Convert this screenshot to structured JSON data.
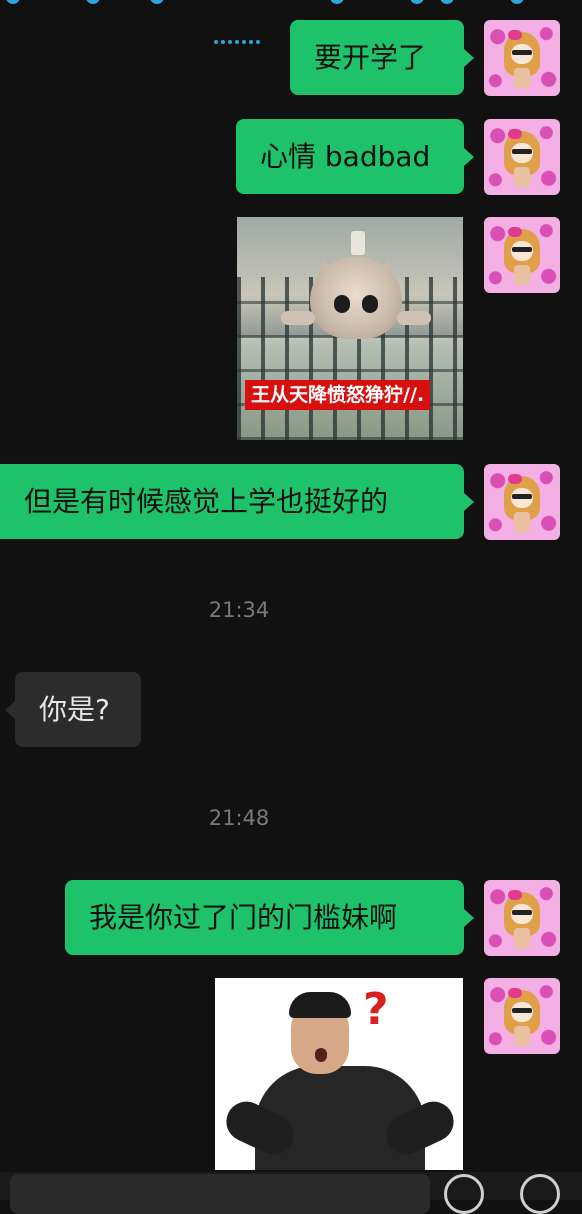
{
  "messages": [
    {
      "type": "text",
      "side": "mine",
      "text": "要开学了"
    },
    {
      "type": "text",
      "side": "mine",
      "text": "心情 badbad"
    },
    {
      "type": "sticker",
      "side": "mine",
      "caption": "王从天降愤怒狰狞//.",
      "icon": "cat-sticker"
    },
    {
      "type": "text",
      "side": "mine",
      "text": "但是有时候感觉上学也挺好的"
    },
    {
      "type": "time",
      "text": "21:34"
    },
    {
      "type": "text",
      "side": "theirs",
      "text": "你是?"
    },
    {
      "type": "time",
      "text": "21:48"
    },
    {
      "type": "text",
      "side": "mine",
      "text": "我是你过了门的门槛妹啊"
    },
    {
      "type": "sticker",
      "side": "mine",
      "icon": "surprised-man-sticker"
    }
  ],
  "colors": {
    "background": "#111111",
    "my_bubble": "#1ec26b",
    "their_bubble": "#2c2c2c",
    "time": "#7a7a7a",
    "accent": "#2aa6d8"
  },
  "icons": {
    "avatar": "anime-girl-avatar",
    "typing": "typing-dots-icon",
    "emoji": "emoji-icon",
    "add": "add-icon"
  }
}
